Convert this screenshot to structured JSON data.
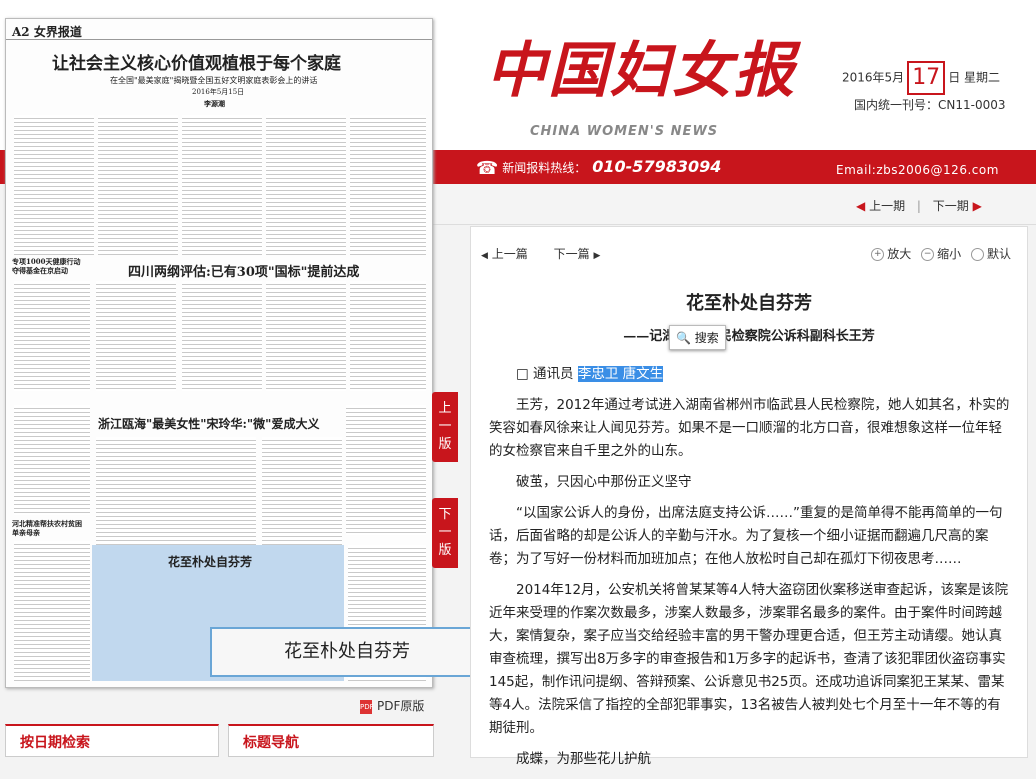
{
  "masthead": {
    "logo": "中国妇女报",
    "logo_en": "CHINA WOMEN'S NEWS",
    "date_prefix": "2016年5月",
    "day": "17",
    "date_suffix": "日  星期二",
    "issn": "国内统一刊号：CN11-0003",
    "hotline_label": "新闻报料热线：",
    "hotline_number": "010-57983094",
    "email": "Email:zbs2006@126.com",
    "prev_page": "上一期",
    "next_page": "下一期"
  },
  "paper": {
    "page_label": "A2",
    "section": "女界报道",
    "headline": "让社会主义核心价值观植根于每个家庭",
    "subhead": "在全国\"最美家庭\"揭晓暨全国五好文明家庭表彰会上的讲话",
    "date_line": "2016年5月15日",
    "author_line": "李源潮",
    "headline2": "四川两纲评估:已有30项\"国标\"提前达成",
    "headline3": "浙江瓯海\"最美女性\"宋玲华:\"微\"爱成大义",
    "side_head1": "专项1000天健康行动夺得基金在京启动",
    "side_head2": "河北精准帮扶农村贫困单亲母亲",
    "highlight_title": "花至朴处自芬芳"
  },
  "popup_label": "花至朴处自芬芳",
  "pdf_label": "PDF原版",
  "side_tabs": {
    "prev": "上\n一\n版",
    "next": "下\n一\n版"
  },
  "bottom": {
    "box1": "按日期检索",
    "box2": "标题导航"
  },
  "article": {
    "prev": "上一篇",
    "next": "下一篇",
    "zoom_in": "放大",
    "zoom_out": "缩小",
    "default": "默认",
    "title": "花至朴处自芬芳",
    "subtitle": "——记湖南省 人民检察院公诉科副科长王芳",
    "search_label": "搜索",
    "byline_prefix": "□ 通讯员 ",
    "byline_names": "李忠卫 唐文生",
    "p1": "王芳，2012年通过考试进入湖南省郴州市临武县人民检察院，她人如其名，朴实的笑容如春风徐来让人闻见芬芳。如果不是一口顺溜的北方口音，很难想象这样一位年轻的女检察官来自千里之外的山东。",
    "p2": "破茧，只因心中那份正义坚守",
    "p3": "“以国家公诉人的身份，出席法庭支持公诉……”重复的是简单得不能再简单的一句话，后面省略的却是公诉人的辛勤与汗水。为了复核一个细小证据而翻遍几尺高的案卷；为了写好一份材料而加班加点；在他人放松时自己却在孤灯下彻夜思考……",
    "p4": "2014年12月，公安机关将曾某某等4人特大盗窃团伙案移送审查起诉，该案是该院近年来受理的作案次数最多，涉案人数最多，涉案罪名最多的案件。由于案件时间跨越大，案情复杂，案子应当交给经验丰富的男干警办理更合适，但王芳主动请缨。她认真审查梳理，撰写出8万多字的审查报告和1万多字的起诉书，查清了该犯罪团伙盗窃事实145起，制作讯问提纲、答辩预案、公诉意见书25页。还成功追诉同案犯王某某、雷某等4人。法院采信了指控的全部犯罪事实，13名被告人被判处七个月至十一年不等的有期徒刑。",
    "p5": "成蝶，为那些花儿护航"
  },
  "colors": {
    "brand_red": "#c8151c",
    "highlight_blue": "#6aa6d6",
    "selection": "#3a8ee6"
  }
}
